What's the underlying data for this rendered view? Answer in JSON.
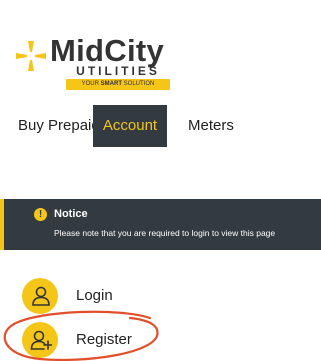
{
  "brand": {
    "name": "MidCity",
    "subname": "UTILITIES",
    "tagline_prefix": "YOUR ",
    "tagline_bold": "SMART",
    "tagline_suffix": " SOLUTION",
    "accent_color": "#f5c518",
    "dark_color": "#333a40"
  },
  "tabs": [
    {
      "label": "Buy Prepaid",
      "active": false
    },
    {
      "label": "Account",
      "active": true
    },
    {
      "label": "Meters",
      "active": false
    }
  ],
  "notice": {
    "icon": "exclamation-icon",
    "title": "Notice",
    "message": "Please note that you are required to login to view this page"
  },
  "menu": {
    "login": {
      "label": "Login",
      "icon": "user-icon"
    },
    "register": {
      "label": "Register",
      "icon": "user-plus-icon"
    }
  },
  "annotation": {
    "color": "#e0502d",
    "shape": "hand-drawn-ellipse"
  }
}
